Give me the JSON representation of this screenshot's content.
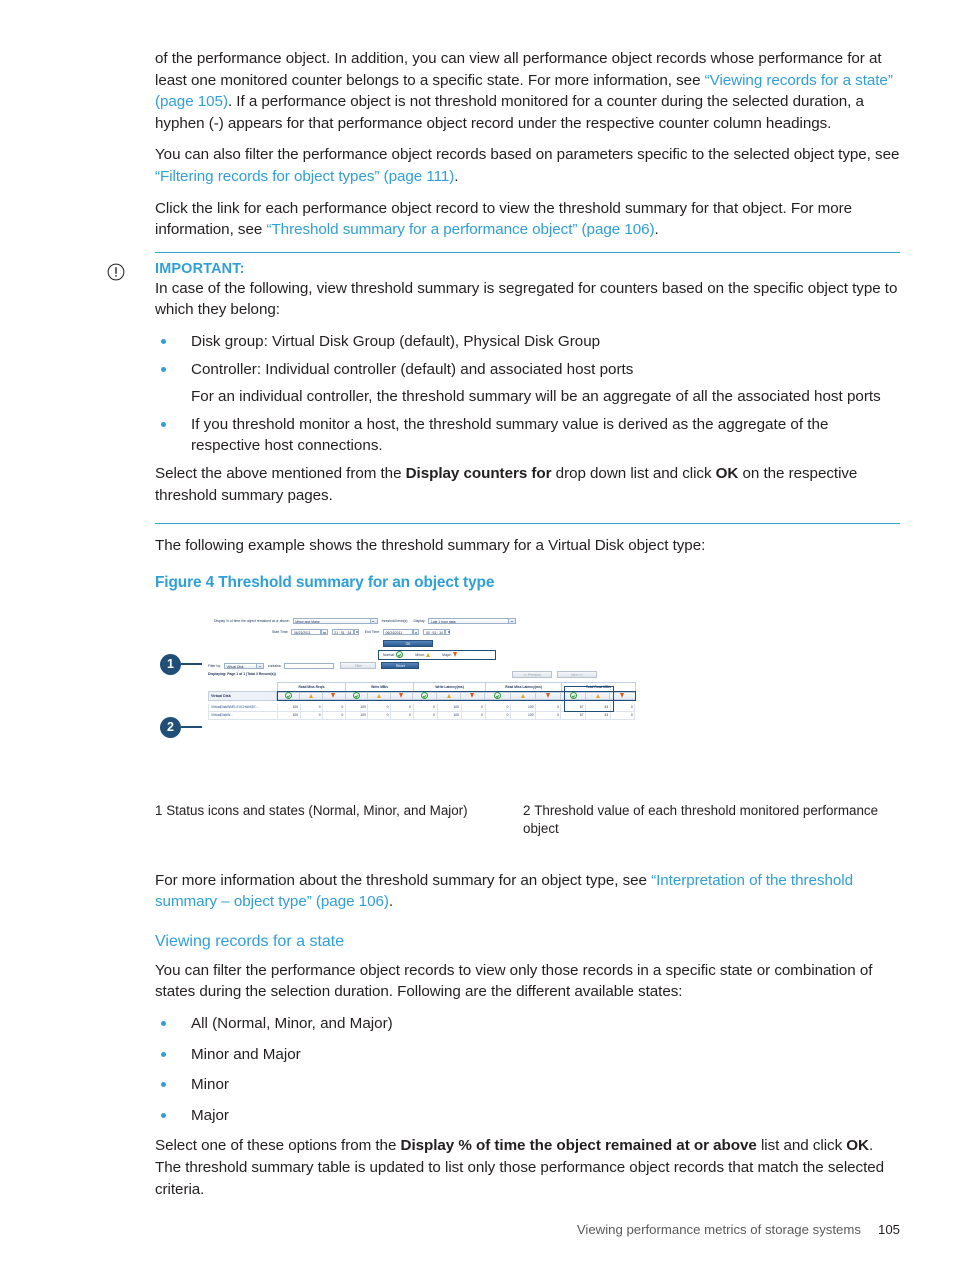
{
  "document": {
    "footer_text": "Viewing performance metrics of storage systems",
    "page_number": "105"
  },
  "paragraphs": {
    "p1_a": "of the performance object. In addition, you can view all performance object records whose performance for at least one monitored counter belongs to a specific state. For more information, see ",
    "p1_link": "“Viewing records for a state” (page 105)",
    "p1_b": ". If a performance object is not threshold monitored for a counter during the selected duration, a hyphen (-) appears for that performance object record under the respective counter column headings.",
    "p2_a": "You can also filter the performance object records based on parameters specific to the selected object type, see ",
    "p2_link": "“Filtering records for object types” (page 111)",
    "p2_b": ".",
    "p3_a": "Click the link for each performance object record to view the threshold summary for that object. For more information, see ",
    "p3_link": "“Threshold summary for a performance object” (page 106)",
    "p3_b": ".",
    "p_example": "The following example shows the threshold summary for a Virtual Disk object type:",
    "p_moreinfo_a": "For more information about the threshold summary for an object type, see ",
    "p_moreinfo_link": "“Interpretation of the threshold summary – object type” (page 106)",
    "p_moreinfo_b": ".",
    "p_filter": "You can filter the performance object records to view only those records in a specific state or combination of states during the selection duration. Following are the different available states:",
    "p_select_a": "Select one of these options from the ",
    "p_select_bold1": "Display % of time the object remained at or above",
    "p_select_b": " list and click ",
    "p_select_bold2": "OK",
    "p_select_c": ". The threshold summary table is updated to list only those performance object records that match the selected criteria."
  },
  "important": {
    "title": "IMPORTANT:",
    "intro": "In case of the following, view threshold summary is segregated for counters based on the specific object type to which they belong:",
    "bullets": [
      {
        "text": "Disk group: Virtual Disk Group (default), Physical Disk Group",
        "sub": ""
      },
      {
        "text": "Controller: Individual controller (default) and associated host ports",
        "sub": "For an individual controller, the threshold summary will be an aggregate of all the associated host ports"
      },
      {
        "text": "If you threshold monitor a host, the threshold summary value is derived as the aggregate of the respective host connections.",
        "sub": ""
      }
    ],
    "closing_a": "Select the above mentioned from the ",
    "closing_bold1": "Display counters for",
    "closing_b": " drop down list and click ",
    "closing_bold2": "OK",
    "closing_c": " on the respective threshold summary pages."
  },
  "figure": {
    "caption": "Figure 4 Threshold summary for an object type",
    "callouts": [
      {
        "num": "1",
        "text": "Status icons and states (Normal, Minor, and Major)"
      },
      {
        "num": "2",
        "text": "Threshold value of each threshold monitored performance object"
      }
    ],
    "screenshot": {
      "display_pct_label": "Display % of time the object remained at or above:",
      "display_pct_value": "Minor and Major",
      "threshold_levels_label": "threshold level(s)",
      "display_label": "Display:",
      "display_value": "Last 1 hour data",
      "start_time_label": "Start Time:",
      "start_date": "06/23/2011",
      "start_clock": "21 : 51 : 34",
      "end_time_label": "End Time:",
      "end_date": "06/24/2011",
      "end_clock": "00 : 51 : 34",
      "ok_button": "OK",
      "legend": {
        "normal_label": "Normal:",
        "minor_label": "Minor:",
        "major_label": "Major:"
      },
      "filter_by_label": "Filter by:",
      "filter_by_value": "Virtual Disk",
      "contains_label": "contains:",
      "contains_value": "",
      "filter_button": "Filter",
      "reset_button": "Reset",
      "paging_text": "Displaying: Page 1 of 1 (Total 3 Record(s))",
      "previous_button": "<< Previous",
      "next_button": "Next >>",
      "object_col_header": "Virtual Disk",
      "counter_headers": [
        "Read Miss Req/s",
        "Write MB/s",
        "Write Latency(ms)",
        "Read Miss Latency(ms)",
        "Total Read MB/s"
      ],
      "state_icons": [
        "normal",
        "minor",
        "major"
      ],
      "rows": [
        {
          "name": "VirtualDiskWMS-EXCHANGE...",
          "values": [
            "100",
            "0",
            "0",
            "100",
            "0",
            "0",
            "0",
            "100",
            "0",
            "0",
            "100",
            "0",
            "57",
            "43",
            "0"
          ]
        },
        {
          "name": "VirtualDiskW...",
          "values": [
            "100",
            "0",
            "0",
            "100",
            "0",
            "0",
            "0",
            "100",
            "0",
            "0",
            "100",
            "0",
            "57",
            "43",
            "0"
          ]
        }
      ]
    }
  },
  "section": {
    "heading": "Viewing records for a state",
    "state_bullets": [
      "All (Normal, Minor, and Major)",
      "Minor and Major",
      "Minor",
      "Major"
    ]
  },
  "colors": {
    "link": "#2f9fd8",
    "heading": "#2f9fd8",
    "callout": "#1f4e79",
    "normal": "#2f9b3f",
    "minor": "#e8a020",
    "major": "#e4591e"
  }
}
